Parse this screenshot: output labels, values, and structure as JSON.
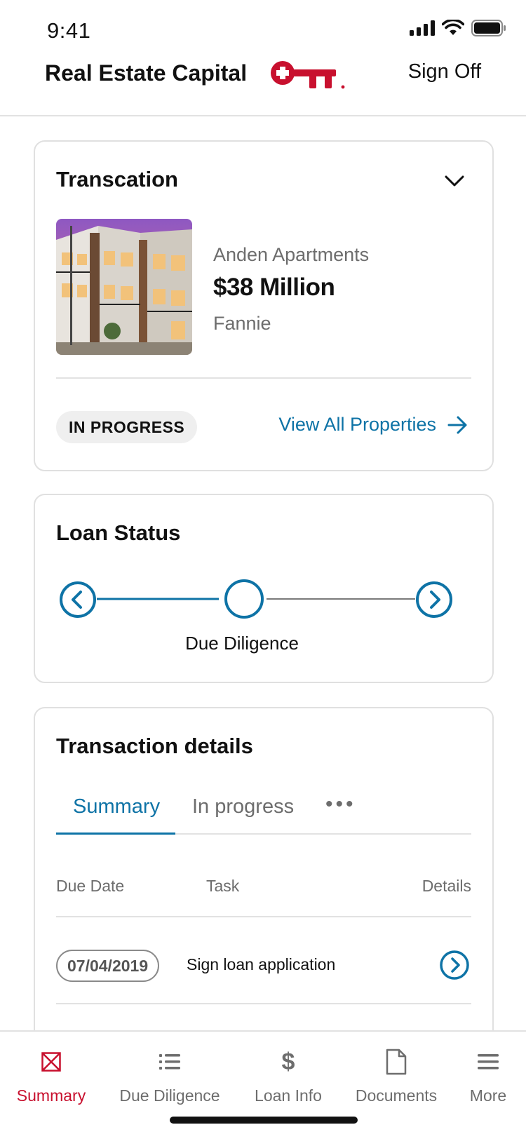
{
  "status_bar": {
    "time": "9:41"
  },
  "header": {
    "title": "Real Estate Capital",
    "sign_off": "Sign Off"
  },
  "transaction": {
    "title": "Transcation",
    "property_name": "Anden Apartments",
    "amount": "$38 Million",
    "lender": "Fannie",
    "status": "IN PROGRESS",
    "view_all": "View All Properties"
  },
  "loan_status": {
    "title": "Loan Status",
    "current_step": "Due Diligence"
  },
  "details": {
    "title": "Transaction details",
    "tabs": [
      {
        "label": "Summary",
        "active": true
      },
      {
        "label": "In progress",
        "active": false
      }
    ],
    "more": "•••",
    "columns": [
      "Due Date",
      "Task",
      "Details"
    ],
    "rows": [
      {
        "due_date": "07/04/2019",
        "task": "Sign loan application"
      }
    ]
  },
  "nav": {
    "items": [
      {
        "label": "Summary",
        "icon": "summary-icon",
        "active": true
      },
      {
        "label": "Due Diligence",
        "icon": "list-icon",
        "active": false
      },
      {
        "label": "Loan Info",
        "icon": "dollar-icon",
        "active": false
      },
      {
        "label": "Documents",
        "icon": "document-icon",
        "active": false
      },
      {
        "label": "More",
        "icon": "menu-icon",
        "active": false
      }
    ]
  },
  "colors": {
    "brand_red": "#c8102e",
    "accent_blue": "#0e73a6",
    "muted_text": "#6d6d6d"
  }
}
